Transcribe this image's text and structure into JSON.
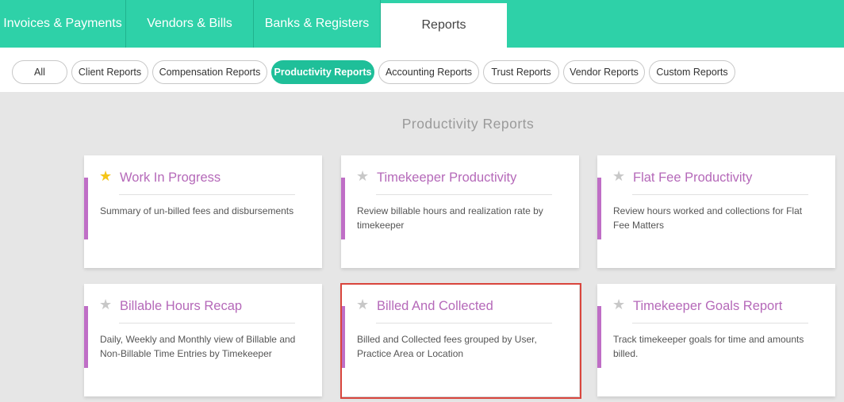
{
  "top_tabs": [
    {
      "label": "Invoices & Payments"
    },
    {
      "label": "Vendors & Bills"
    },
    {
      "label": "Banks & Registers"
    },
    {
      "label": "Reports"
    }
  ],
  "filters": [
    {
      "label": "All"
    },
    {
      "label": "Client Reports"
    },
    {
      "label": "Compensation Reports"
    },
    {
      "label": "Productivity Reports"
    },
    {
      "label": "Accounting Reports"
    },
    {
      "label": "Trust Reports"
    },
    {
      "label": "Vendor Reports"
    },
    {
      "label": "Custom Reports"
    }
  ],
  "selected_filter": "Productivity Reports",
  "section_title": "Productivity Reports",
  "cards": [
    {
      "title": "Work In Progress",
      "description": "Summary of un-billed fees and disbursements",
      "favorite": true
    },
    {
      "title": "Timekeeper Productivity",
      "description": "Review billable hours and realization rate by timekeeper",
      "favorite": false
    },
    {
      "title": "Flat Fee Productivity",
      "description": "Review hours worked and collections for Flat Fee Matters",
      "favorite": false
    },
    {
      "title": "Billable Hours Recap",
      "description": "Daily, Weekly and Monthly view of Billable and Non-Billable Time Entries by Timekeeper",
      "favorite": false
    },
    {
      "title": "Billed And Collected",
      "description": "Billed and Collected fees grouped by User, Practice Area or Location",
      "favorite": false
    },
    {
      "title": "Timekeeper Goals Report",
      "description": "Track timekeeper goals for time and amounts billed.",
      "favorite": false
    }
  ],
  "colors": {
    "nav": "#2ed1a8",
    "active_pill": "#1fbf99",
    "card_title": "#b569b9",
    "card_accent": "#bf6ec6",
    "star_favorite": "#f5c518",
    "highlight": "#d9453d"
  },
  "icons": {
    "star": "star-icon"
  }
}
